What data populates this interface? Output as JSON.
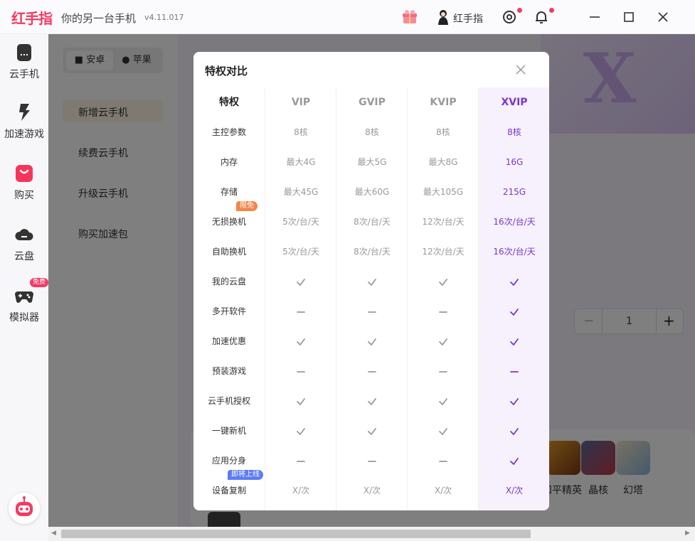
{
  "titlebar": {
    "brand": "红手指",
    "slogan": "你的另一台手机",
    "version": "v4.11.017",
    "username": "红手指"
  },
  "sidebar": {
    "items": [
      {
        "label": "云手机",
        "icon": "phone-icon"
      },
      {
        "label": "加速游戏",
        "icon": "lightning-icon"
      },
      {
        "label": "购买",
        "icon": "shopping-bag-icon"
      },
      {
        "label": "云盘",
        "icon": "cloud-icon"
      },
      {
        "label": "模拟器",
        "icon": "gamepad-icon"
      }
    ],
    "free_badge": "免费"
  },
  "background": {
    "os_tabs": [
      "安卓",
      "苹果"
    ],
    "menu": [
      "新增云手机",
      "续费云手机",
      "升级云手机",
      "购买加速包"
    ],
    "quantity": "1",
    "games": [
      "和平精英",
      "晶核",
      "幻塔"
    ]
  },
  "modal": {
    "title": "特权对比",
    "columns": [
      "特权",
      "VIP",
      "GVIP",
      "KVIP",
      "XVIP"
    ],
    "rows": [
      {
        "label": "主控参数",
        "values": [
          "8核",
          "8核",
          "8核",
          "8核"
        ]
      },
      {
        "label": "内存",
        "values": [
          "最大4G",
          "最大5G",
          "最大8G",
          "16G"
        ]
      },
      {
        "label": "存储",
        "values": [
          "最大45G",
          "最大60G",
          "最大105G",
          "215G"
        ]
      },
      {
        "label": "无损换机",
        "values": [
          "5次/台/天",
          "8次/台/天",
          "12次/台/天",
          "16次/台/天"
        ],
        "tag": "限免"
      },
      {
        "label": "自助换机",
        "values": [
          "5次/台/天",
          "8次/台/天",
          "12次/台/天",
          "16次/台/天"
        ]
      },
      {
        "label": "我的云盘",
        "values": [
          "check",
          "check",
          "check",
          "check"
        ]
      },
      {
        "label": "多开软件",
        "values": [
          "dash",
          "dash",
          "dash",
          "check"
        ]
      },
      {
        "label": "加速优惠",
        "values": [
          "check",
          "check",
          "check",
          "check"
        ]
      },
      {
        "label": "预装游戏",
        "values": [
          "dash",
          "dash",
          "dash",
          "dash"
        ]
      },
      {
        "label": "云手机授权",
        "values": [
          "check",
          "check",
          "check",
          "check"
        ]
      },
      {
        "label": "一键新机",
        "values": [
          "check",
          "check",
          "check",
          "check"
        ]
      },
      {
        "label": "应用分身",
        "values": [
          "dash",
          "dash",
          "dash",
          "check"
        ]
      },
      {
        "label": "设备复制",
        "values": [
          "X/次",
          "X/次",
          "X/次",
          "X/次"
        ],
        "tag": "即将上线"
      }
    ]
  },
  "colors": {
    "brand": "#f23b63",
    "xvip": "#7a37c9",
    "xvip_bg": "#f6f1fd"
  }
}
